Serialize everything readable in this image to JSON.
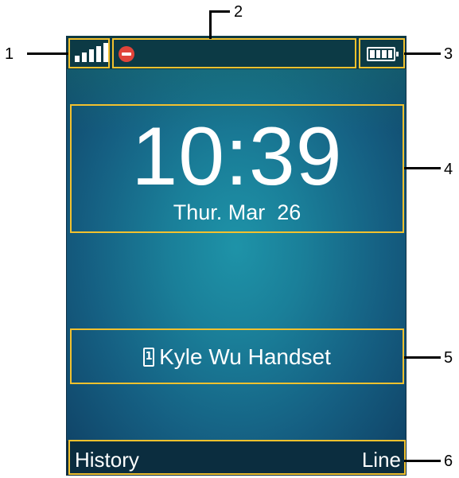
{
  "status_bar": {
    "signal_icon": "signal-strength-icon",
    "missed_icon": "missed-call-icon",
    "battery_icon": "battery-full-icon"
  },
  "clock": {
    "time": "10:39",
    "date": "Thur. Mar  26"
  },
  "handset": {
    "icon_number": "1",
    "name": "Kyle Wu Handset"
  },
  "softkeys": {
    "left": "History",
    "right": "Line"
  },
  "callouts": {
    "c1": "1",
    "c2": "2",
    "c3": "3",
    "c4": "4",
    "c5": "5",
    "c6": "6"
  },
  "colors": {
    "highlight": "#f2c12e",
    "screen_center": "#1e93a8",
    "screen_edge": "#0f3f63",
    "missed": "#e0443a"
  }
}
